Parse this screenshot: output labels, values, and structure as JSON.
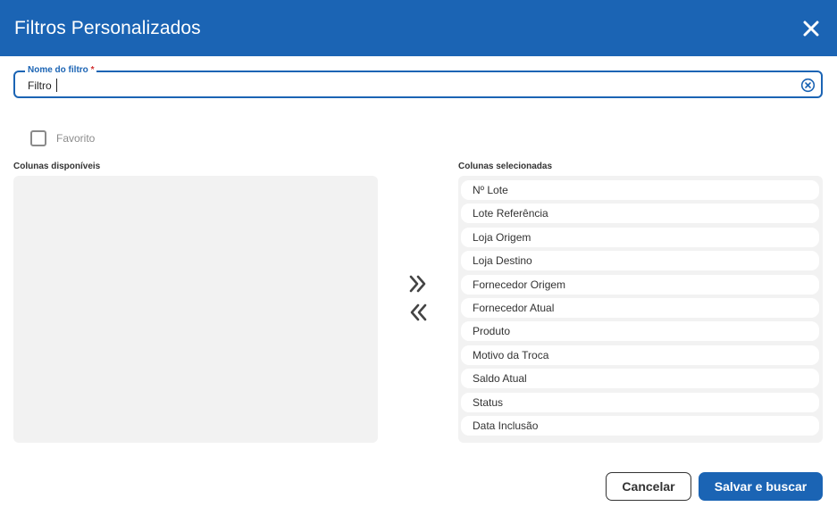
{
  "dialog": {
    "title": "Filtros Personalizados"
  },
  "filter_name": {
    "label": "Nome do filtro",
    "required_mark": "*",
    "value": "Filtro"
  },
  "favorite": {
    "label": "Favorito",
    "checked": false
  },
  "available_columns": {
    "title": "Colunas disponíveis",
    "items": []
  },
  "selected_columns": {
    "title": "Colunas selecionadas",
    "items": [
      "Nº Lote",
      "Lote Referência",
      "Loja Origem",
      "Loja Destino",
      "Fornecedor Origem",
      "Fornecedor Atual",
      "Produto",
      "Motivo da Troca",
      "Saldo Atual",
      "Status",
      "Data Inclusão"
    ]
  },
  "actions": {
    "cancel_label": "Cancelar",
    "save_label": "Salvar e buscar"
  },
  "colors": {
    "primary": "#1b64b4",
    "required": "#d23030",
    "panel": "#f2f2f2"
  }
}
